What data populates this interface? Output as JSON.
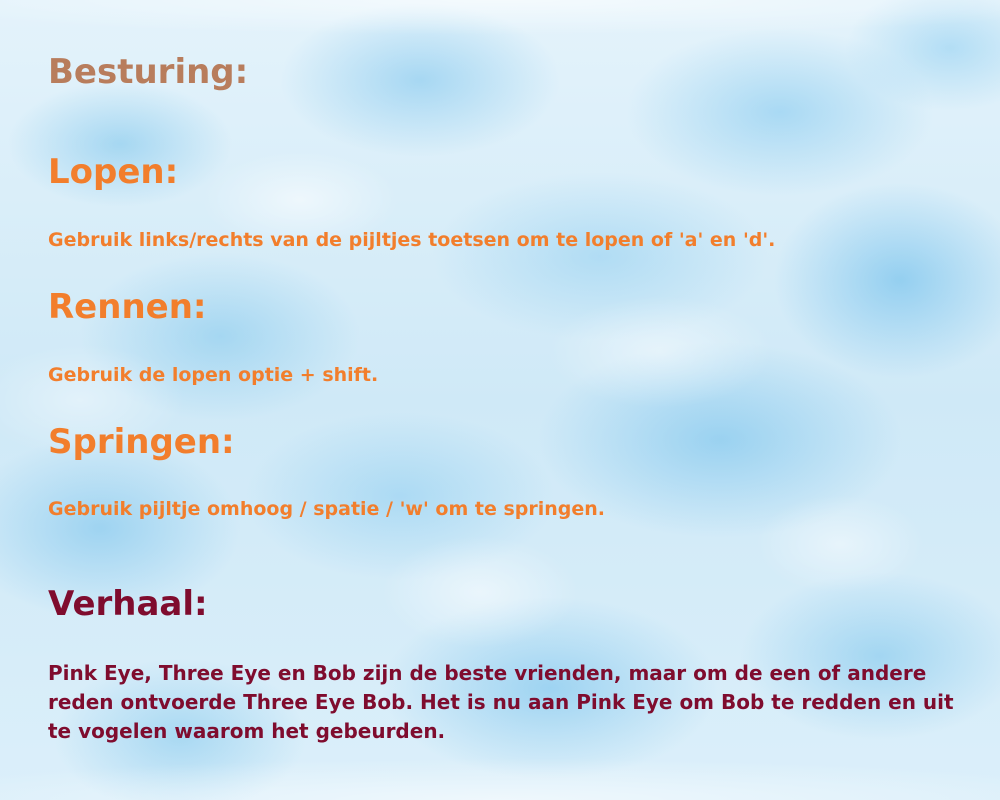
{
  "controls": {
    "title": "Besturing:",
    "sections": [
      {
        "title": "Lopen:",
        "text": "Gebruik links/rechts van de pijltjes toetsen om te lopen of 'a' en 'd'."
      },
      {
        "title": "Rennen:",
        "text": "Gebruik de lopen optie + shift."
      },
      {
        "title": "Springen:",
        "text": "Gebruik pijltje omhoog / spatie / 'w' om te springen."
      }
    ]
  },
  "story": {
    "title": "Verhaal:",
    "text": "Pink Eye, Three Eye en Bob zijn de beste vrienden, maar om de een of andere reden ontvoerde Three Eye Bob. Het is nu aan Pink Eye om Bob te redden en uit te vogelen waarom het gebeurden."
  },
  "colors": {
    "heading": "#b87d5c",
    "controls_accent": "#f27e2c",
    "story_accent": "#7f0c2e",
    "sky": "#d7eefa"
  }
}
